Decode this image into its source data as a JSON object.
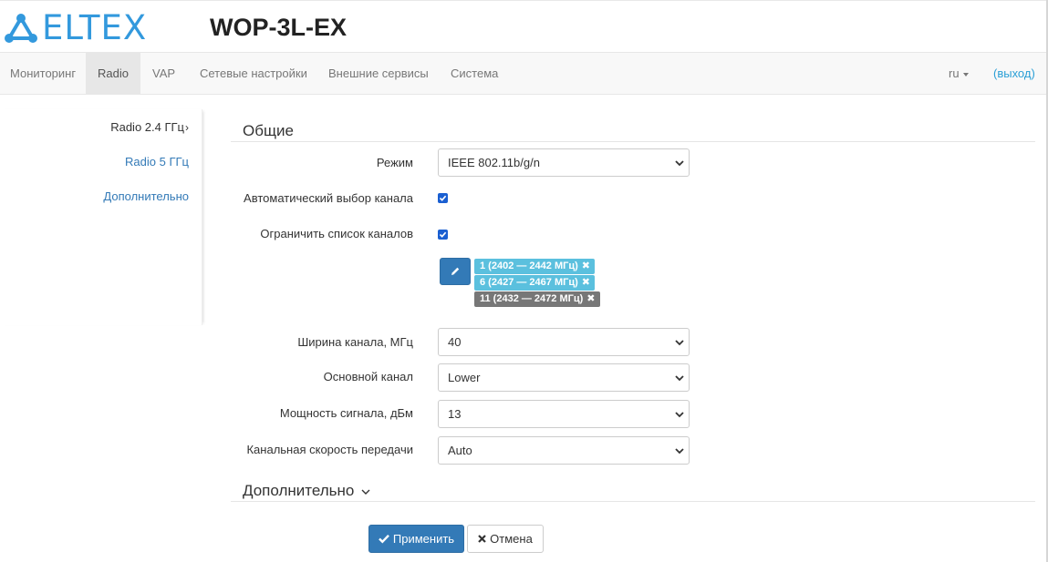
{
  "header": {
    "logo_text": "ELTEX",
    "device_title": "WOP-3L-EX"
  },
  "navbar": {
    "items": [
      {
        "label": "Мониторинг"
      },
      {
        "label": "Radio"
      },
      {
        "label": "VAP"
      },
      {
        "label": "Сетевые настройки"
      },
      {
        "label": "Внешние сервисы"
      },
      {
        "label": "Система"
      }
    ],
    "active": "Radio",
    "lang": "ru",
    "logout": "(выход)"
  },
  "sidebar": {
    "items": [
      {
        "label": "Radio 2.4 ГГц",
        "active": true
      },
      {
        "label": "Radio 5 ГГц",
        "active": false
      },
      {
        "label": "Дополнительно",
        "active": false
      }
    ]
  },
  "general": {
    "title": "Общие",
    "mode": {
      "label": "Режим",
      "value": "IEEE 802.11b/g/n"
    },
    "auto_channel": {
      "label": "Автоматический выбор канала",
      "checked": true
    },
    "limit_channels": {
      "label": "Ограничить список каналов",
      "checked": true
    },
    "channels": [
      {
        "text": "1 (2402 — 2442 МГц)",
        "style": "info"
      },
      {
        "text": "6 (2427 — 2467 МГц)",
        "style": "info"
      },
      {
        "text": "11 (2432 — 2472 МГц)",
        "style": "default"
      }
    ],
    "bandwidth": {
      "label": "Ширина канала, МГц",
      "value": "40"
    },
    "primary_channel": {
      "label": "Основной канал",
      "value": "Lower"
    },
    "tx_power": {
      "label": "Мощность сигнала, дБм",
      "value": "13"
    },
    "data_rate": {
      "label": "Канальная скорость передачи",
      "value": "Auto"
    }
  },
  "advanced": {
    "title": "Дополнительно"
  },
  "actions": {
    "apply": "Применить",
    "cancel": "Отмена"
  },
  "colors": {
    "primary": "#337ab7",
    "info_tag": "#5bc0de",
    "default_tag": "#777777",
    "logo": "#3399dd",
    "link": "#2a9fd6"
  },
  "icons": {
    "edit": "pencil-icon",
    "apply": "check-icon",
    "cancel": "x-icon",
    "tag_remove": "x-icon",
    "select_arrow": "chevron-down-icon"
  }
}
